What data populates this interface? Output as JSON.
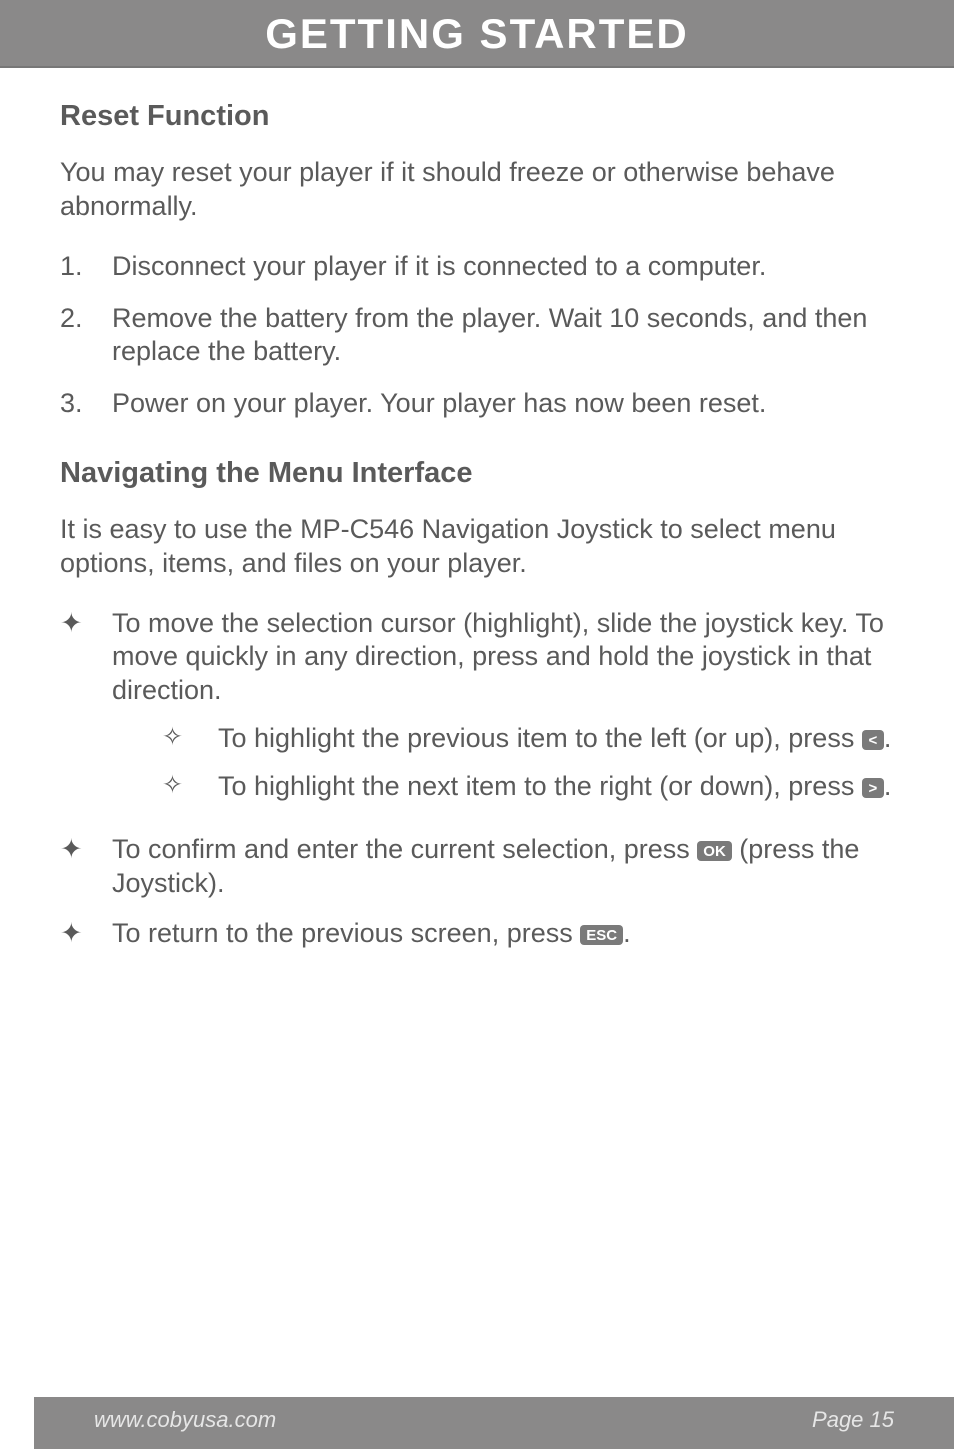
{
  "banner": {
    "title": "GETTING STARTED"
  },
  "s1": {
    "heading": "Reset Function",
    "intro": "You may reset your player if it should freeze or otherwise behave abnormally.",
    "steps": [
      {
        "n": "1.",
        "t": "Disconnect your player if it is connected to a computer."
      },
      {
        "n": "2.",
        "t": "Remove the battery from the player. Wait 10 seconds, and then replace the battery."
      },
      {
        "n": "3.",
        "t": "Power on your player. Your player has now been reset."
      }
    ]
  },
  "s2": {
    "heading": "Navigating the Menu Interface",
    "intro": "It is easy to use the MP-C546 Navigation Joystick to select menu options, items, and files on your player.",
    "b1": "To move the selection cursor (highlight), slide the joystick key. To move quickly in any direction, press and hold the joystick in that direction.",
    "b1s1a": "To highlight the previous item to the left (or up), press ",
    "b1s1b": ".",
    "b1s2a": "To highlight the next item to the right (or down), press ",
    "b1s2b": ".",
    "b2a": "To confirm and enter the current selection, press ",
    "b2b": " (press the Joystick).",
    "b3a": "To return to the previous screen, press ",
    "b3b": "."
  },
  "keys": {
    "left": "<",
    "right": ">",
    "ok": "OK",
    "esc": "ESC"
  },
  "bullets": {
    "star4": "✦",
    "diamond": "✧"
  },
  "footer": {
    "url": "www.cobyusa.com",
    "page": "Page 15"
  }
}
